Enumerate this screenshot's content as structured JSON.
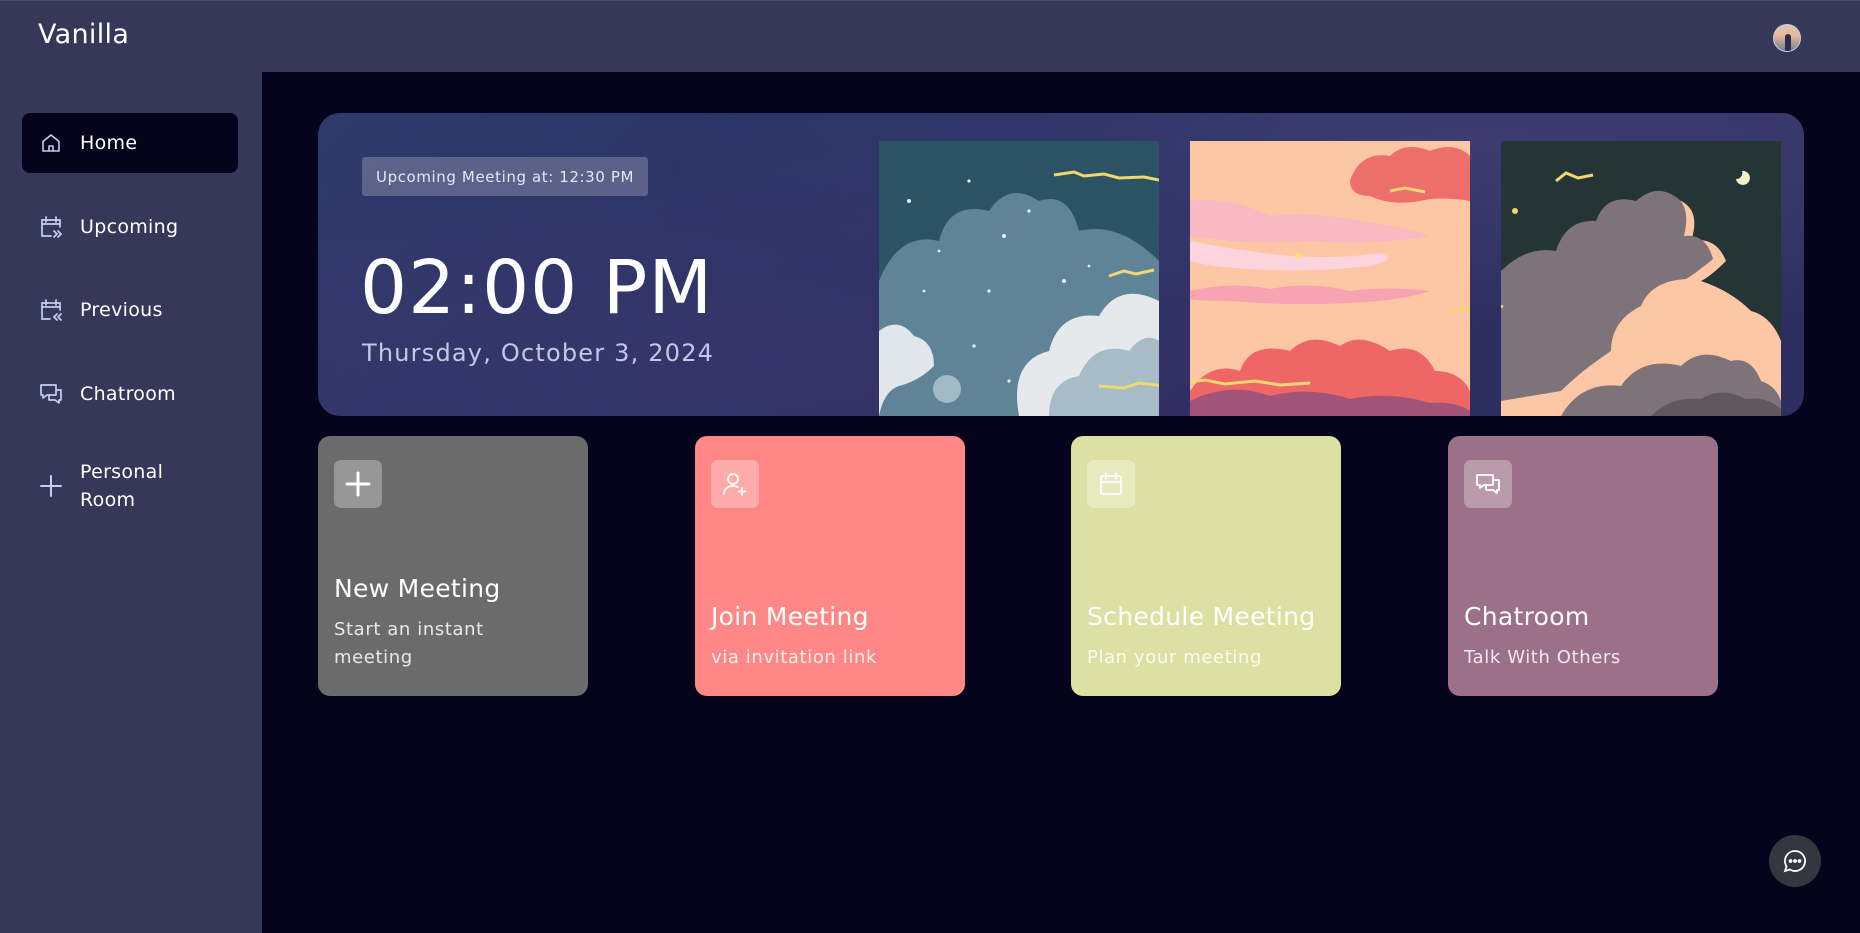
{
  "app": {
    "title": "Vanilla"
  },
  "colors": {
    "background": "#06041d",
    "sidebar": "#363859",
    "card_new": "#6b6b6b",
    "card_join": "#ff8785",
    "card_schedule": "#dde0a3",
    "card_chat": "#9c7089"
  },
  "sidebar": {
    "items": [
      {
        "label": "Home",
        "icon": "home-icon",
        "active": true
      },
      {
        "label": "Upcoming",
        "icon": "calendar-upcoming-icon"
      },
      {
        "label": "Previous",
        "icon": "calendar-previous-icon"
      },
      {
        "label": "Chatroom",
        "icon": "chat-bubbles-icon"
      },
      {
        "label": "Personal\nRoom",
        "icon": "plus-icon"
      }
    ]
  },
  "hero": {
    "badge": "Upcoming Meeting at: 12:30 PM",
    "time": "02:00 PM",
    "date": "Thursday, October 3, 2024"
  },
  "cards": [
    {
      "title": "New Meeting",
      "subtitle": "Start an instant meeting",
      "icon": "plus-icon"
    },
    {
      "title": "Join Meeting",
      "subtitle": "via invitation link",
      "icon": "add-user-icon"
    },
    {
      "title": "Schedule Meeting",
      "subtitle": "Plan your meeting",
      "icon": "calendar-icon"
    },
    {
      "title": "Chatroom",
      "subtitle": "Talk With Others",
      "icon": "chat-bubbles-icon"
    }
  ],
  "fab": {
    "icon": "chat-dots-icon"
  }
}
